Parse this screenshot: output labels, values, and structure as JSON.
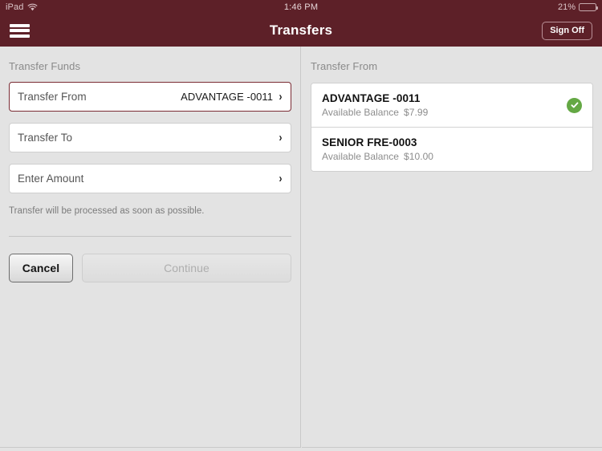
{
  "status_bar": {
    "device": "iPad",
    "wifi_icon": "wifi-icon",
    "time": "1:46 PM",
    "battery_percent": "21%",
    "battery_level": 21
  },
  "nav": {
    "menu_icon": "hamburger-menu-icon",
    "title": "Transfers",
    "sign_off_label": "Sign Off"
  },
  "colors": {
    "brand_maroon": "#5d2028",
    "active_field_border": "#7a2b33",
    "success_green": "#64a844",
    "page_background": "#e3e3e3"
  },
  "left_pane": {
    "section_label": "Transfer Funds",
    "fields": [
      {
        "label": "Transfer From",
        "value": "ADVANTAGE -0011",
        "active": true,
        "chevron": "›"
      },
      {
        "label": "Transfer To",
        "value": "",
        "active": false,
        "chevron": "›"
      },
      {
        "label": "Enter Amount",
        "value": "",
        "active": false,
        "chevron": "›"
      }
    ],
    "note": "Transfer will be processed as soon as possible.",
    "buttons": {
      "cancel_label": "Cancel",
      "continue_label": "Continue",
      "continue_disabled": true
    }
  },
  "right_pane": {
    "section_label": "Transfer From",
    "accounts": [
      {
        "name": "ADVANTAGE -0011",
        "balance_label": "Available Balance",
        "balance_amount": "$7.99",
        "selected": true
      },
      {
        "name": "SENIOR FRE-0003",
        "balance_label": "Available Balance",
        "balance_amount": "$10.00",
        "selected": false
      }
    ]
  }
}
